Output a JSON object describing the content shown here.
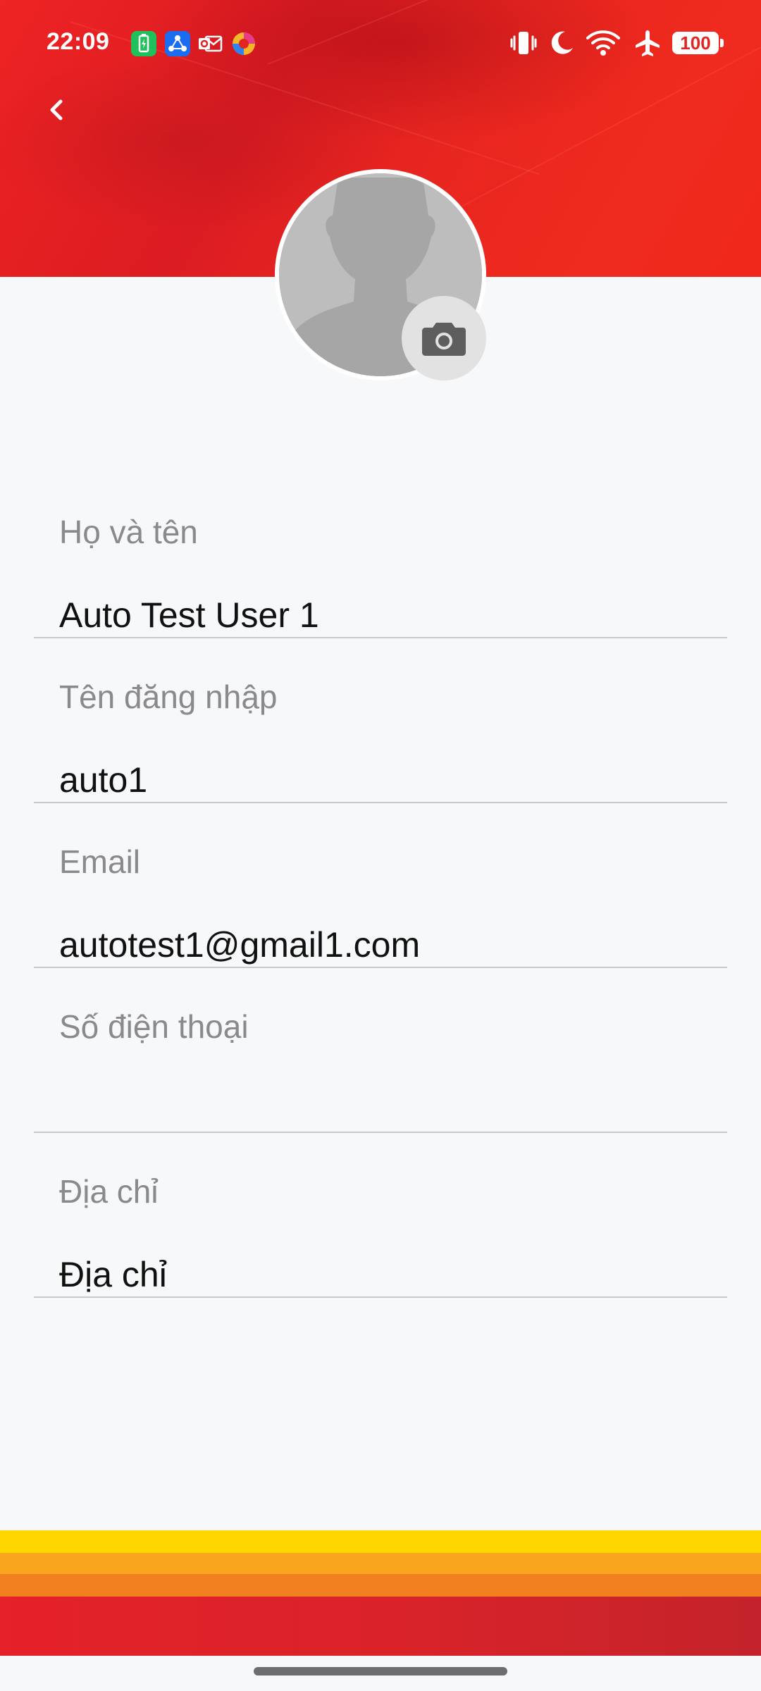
{
  "status_bar": {
    "time": "22:09",
    "battery": "100",
    "notification_icons": [
      "battery-saver-icon",
      "share-icon",
      "outlook-icon",
      "browser-icon"
    ],
    "system_icons": [
      "vibrate-icon",
      "do-not-disturb-moon-icon",
      "wifi-icon",
      "airplane-mode-icon",
      "battery-icon"
    ]
  },
  "header": {
    "back_icon": "chevron-left-icon",
    "avatar_icon": "default-person-silhouette",
    "camera_icon": "camera-icon"
  },
  "form": {
    "full_name": {
      "label": "Họ và tên",
      "value": "Auto Test User 1"
    },
    "username": {
      "label": "Tên đăng nhập",
      "value": "auto1"
    },
    "email": {
      "label": "Email",
      "value": "autotest1@gmail1.com"
    },
    "phone": {
      "label": "Số điện thoại",
      "value": ""
    },
    "address": {
      "label": "Địa chỉ",
      "value": "Địa chỉ"
    }
  },
  "colors": {
    "header_red": "#e3241f",
    "background": "#f7f8fa",
    "label_gray": "#8a8a8e",
    "value_black": "#111111",
    "divider": "#c9c9cc",
    "footer_yellow": "#fed600",
    "footer_orange_light": "#f8a61e",
    "footer_orange": "#f2801f",
    "footer_red": "#e52129"
  }
}
